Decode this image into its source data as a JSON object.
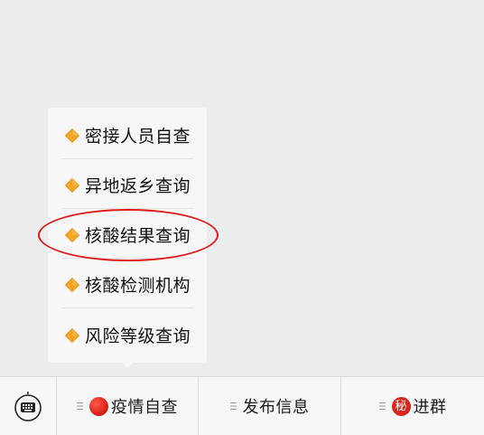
{
  "popup_menu": {
    "items": [
      {
        "label": "密接人员自查"
      },
      {
        "label": "异地返乡查询"
      },
      {
        "label": "核酸结果查询"
      },
      {
        "label": "核酸检测机构"
      },
      {
        "label": "风险等级查询"
      }
    ],
    "highlighted_item": "核酸结果查询"
  },
  "bottom_bar": {
    "tabs": [
      {
        "label": "疫情自查",
        "icon": "red-dot-icon"
      },
      {
        "label": "发布信息"
      },
      {
        "label": "进群",
        "badge": "秘"
      }
    ]
  },
  "colors": {
    "diamond_fill": "#f5a623",
    "highlight_circle": "#e01a1a",
    "badge_red": "#d9251c"
  }
}
